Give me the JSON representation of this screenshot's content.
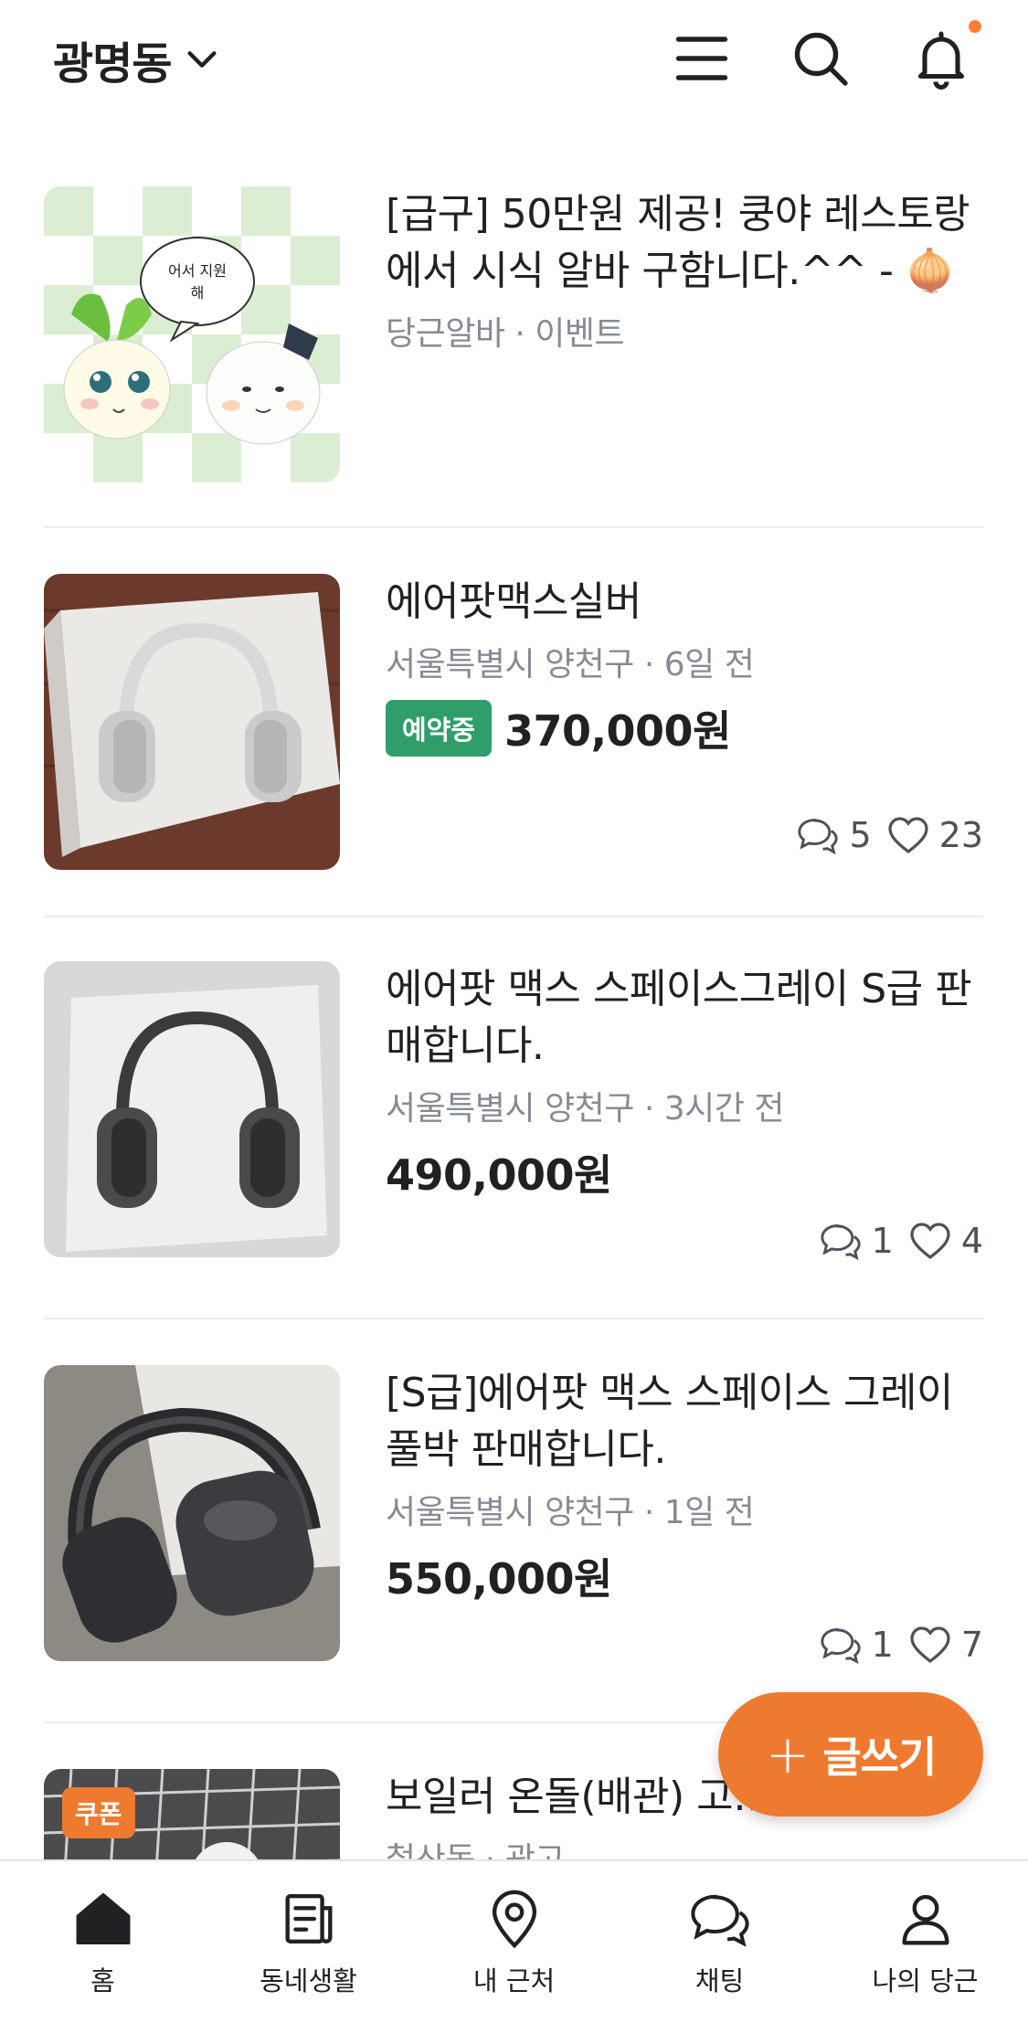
{
  "header": {
    "location": "광명동",
    "icons": [
      "chevron-down-icon",
      "menu-icon",
      "search-icon",
      "bell-icon"
    ],
    "notification_dot_color": "#ff7e36"
  },
  "items": [
    {
      "title": "[급구] 50만원 제공! 쿵야 레스토랑에서 시식 알바 구함니다.^^ - 🧅",
      "meta": "당근알바 · 이벤트",
      "thumb_caption": "어서 지원해"
    },
    {
      "title": "에어팟맥스실버",
      "meta": "서울특별시 양천구 · 6일 전",
      "badge": "예약중",
      "price": "370,000원",
      "comments": "5",
      "likes": "23"
    },
    {
      "title": "에어팟 맥스 스페이스그레이 S급 판매합니다.",
      "meta": "서울특별시 양천구 · 3시간 전",
      "price": "490,000원",
      "comments": "1",
      "likes": "4"
    },
    {
      "title": "[S급]에어팟 맥스 스페이스 그레이 풀박 판매합니다.",
      "meta": "서울특별시 양천구 · 1일 전",
      "price": "550,000원",
      "comments": "1",
      "likes": "7"
    },
    {
      "title": "보일러 온돌(배관) 고…",
      "meta": "철산동 · 광고",
      "coupon": "쿠폰"
    }
  ],
  "fab": {
    "label": "글쓰기",
    "color": "#ee7a30"
  },
  "nav": [
    {
      "label": "홈",
      "icon": "home-icon"
    },
    {
      "label": "동네생활",
      "icon": "newspaper-icon"
    },
    {
      "label": "내 근처",
      "icon": "location-pin-icon"
    },
    {
      "label": "채팅",
      "icon": "chat-icon"
    },
    {
      "label": "나의 당근",
      "icon": "user-icon"
    }
  ],
  "badge_color": "#2f9e6b"
}
